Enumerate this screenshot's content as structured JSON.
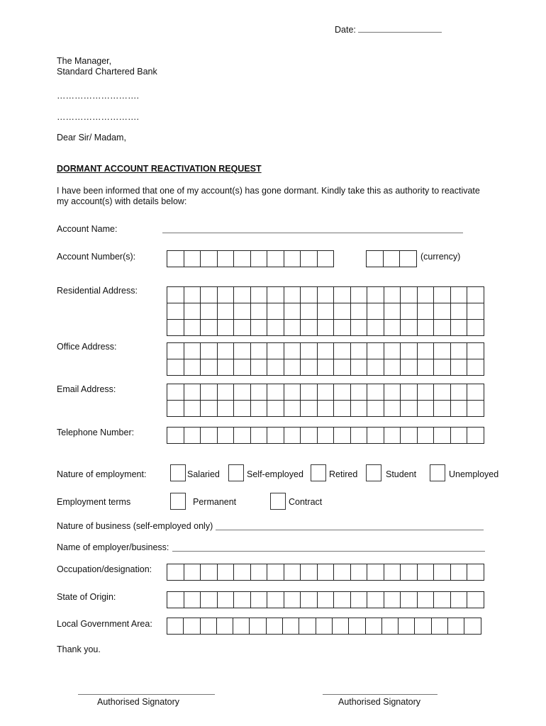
{
  "date_label": "Date:",
  "recipient": {
    "line1": "The Manager,",
    "line2": "Standard Chartered Bank",
    "dots1": "……………………….",
    "dots2": "………………………."
  },
  "salutation": "Dear Sir/ Madam,",
  "title": "DORMANT ACCOUNT REACTIVATION REQUEST",
  "intro": {
    "line1": "I have been informed that one of my account(s) has gone dormant. Kindly take this as authority to reactivate",
    "line2": "my account(s) with details below:"
  },
  "fields": {
    "account_name": "Account Name:",
    "account_number": "Account Number(s):",
    "currency": "(currency)",
    "residential_address": "Residential Address:",
    "office_address": "Office Address:",
    "email_address": "Email Address:",
    "telephone": "Telephone Number:",
    "nature_employment": "Nature of employment:",
    "employment_terms": "Employment terms",
    "nature_business": "Nature of business (self-employed only)",
    "employer_name": "Name of employer/business:",
    "occupation": "Occupation/designation:",
    "state_origin": "State of Origin:",
    "lga": "Local Government Area:"
  },
  "employment_options": [
    "Salaried",
    "Self-employed",
    "Retired",
    "Student",
    "Unemployed"
  ],
  "term_options": [
    "Permanent",
    "Contract"
  ],
  "closing": "Thank you.",
  "signatures": [
    "Authorised Signatory",
    "Authorised Signatory"
  ]
}
